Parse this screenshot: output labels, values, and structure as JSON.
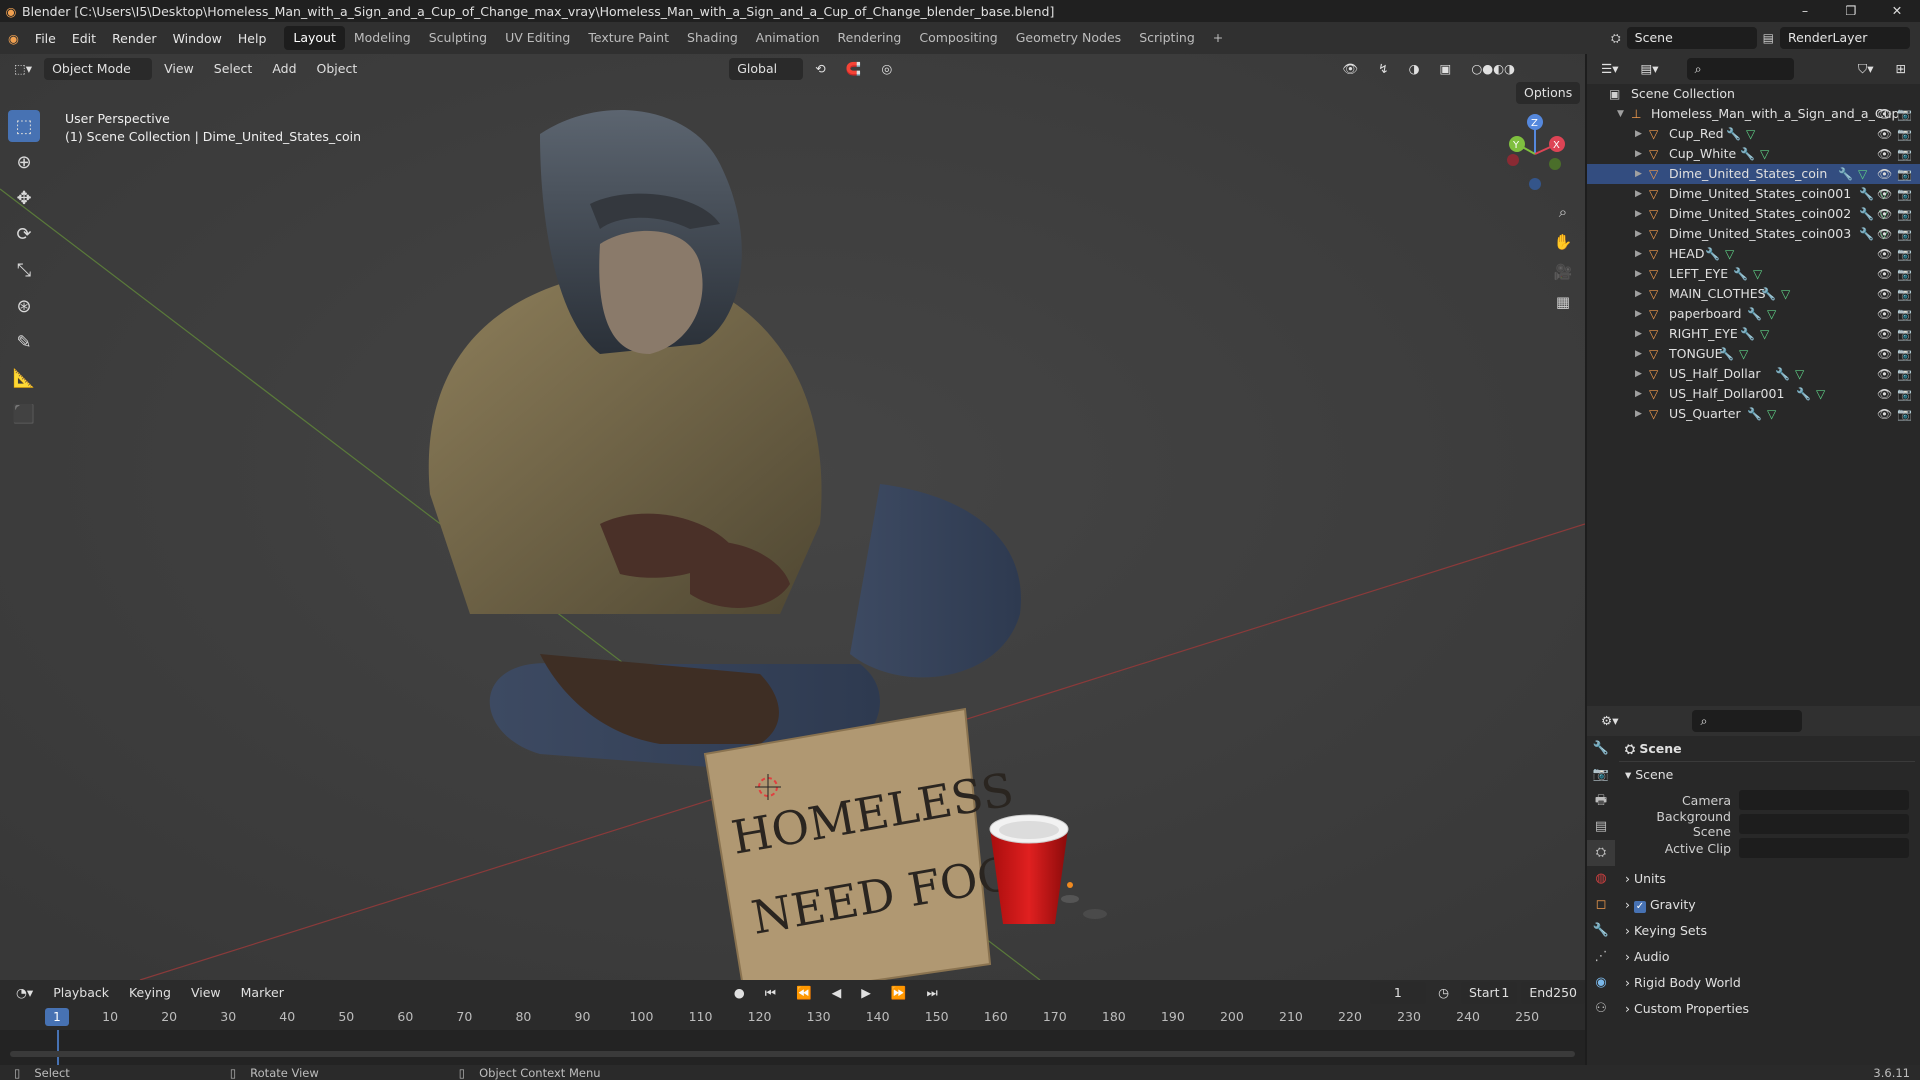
{
  "titlebar": {
    "title": "Blender [C:\\Users\\I5\\Desktop\\Homeless_Man_with_a_Sign_and_a_Cup_of_Change_max_vray\\Homeless_Man_with_a_Sign_and_a_Cup_of_Change_blender_base.blend]",
    "minimize": "–",
    "maximize": "❐",
    "close": "✕"
  },
  "menu": [
    "File",
    "Edit",
    "Render",
    "Window",
    "Help"
  ],
  "workspaces": [
    "Layout",
    "Modeling",
    "Sculpting",
    "UV Editing",
    "Texture Paint",
    "Shading",
    "Animation",
    "Rendering",
    "Compositing",
    "Geometry Nodes",
    "Scripting",
    "+"
  ],
  "active_workspace": "Layout",
  "scene_name": "Scene",
  "view_layer": "RenderLayer",
  "viewport": {
    "mode": "Object Mode",
    "menus": [
      "View",
      "Select",
      "Add",
      "Object"
    ],
    "orientation": "Global",
    "options_label": "Options",
    "info_line1": "User Perspective",
    "info_line2": "(1) Scene Collection | Dime_United_States_coin",
    "gizmo_z": "Z",
    "gizmo_y": "Y",
    "gizmo_x": "X"
  },
  "sign": {
    "line1": "HOMELESS",
    "line2": "NEED FOOD"
  },
  "outliner": {
    "root": "Scene Collection",
    "collection": "Homeless_Man_with_a_Sign_and_a_Cup",
    "items": [
      "Cup_Red",
      "Cup_White",
      "Dime_United_States_coin",
      "Dime_United_States_coin001",
      "Dime_United_States_coin002",
      "Dime_United_States_coin003",
      "HEAD",
      "LEFT_EYE",
      "MAIN_CLOTHES",
      "paperboard",
      "RIGHT_EYE",
      "TONGUE",
      "US_Half_Dollar",
      "US_Half_Dollar001",
      "US_Quarter"
    ],
    "selected": "Dime_United_States_coin"
  },
  "properties": {
    "header": "Scene",
    "section": "Scene",
    "camera_label": "Camera",
    "background_label": "Background Scene",
    "clip_label": "Active Clip",
    "panels": [
      "Units",
      "Gravity",
      "Keying Sets",
      "Audio",
      "Rigid Body World",
      "Custom Properties"
    ],
    "gravity_checked": true
  },
  "timeline": {
    "menus": [
      "Playback",
      "Keying",
      "View",
      "Marker"
    ],
    "current_frame": "1",
    "start_label": "Start",
    "start": "1",
    "end_label": "End",
    "end": "250",
    "ticks": [
      "10",
      "20",
      "30",
      "40",
      "50",
      "60",
      "70",
      "80",
      "90",
      "100",
      "110",
      "120",
      "130",
      "140",
      "150",
      "160",
      "170",
      "180",
      "190",
      "200",
      "210",
      "220",
      "230",
      "240",
      "250"
    ]
  },
  "statusbar": {
    "select": "Select",
    "rotate": "Rotate View",
    "context": "Object Context Menu",
    "version": "3.6.11"
  }
}
